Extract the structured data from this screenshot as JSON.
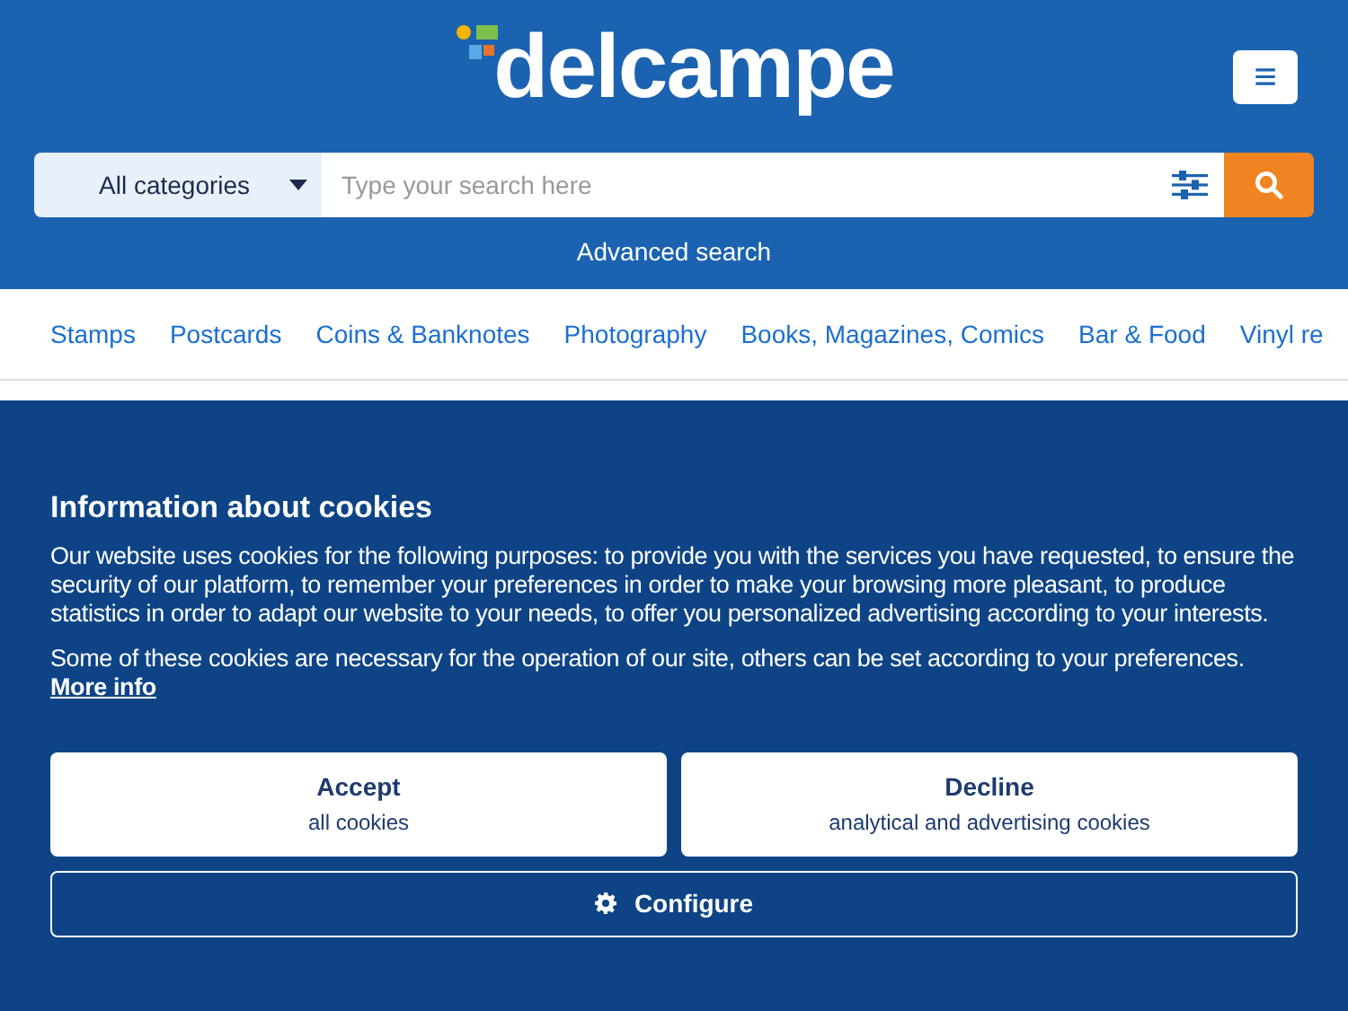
{
  "header": {
    "logo": "delcampe",
    "menu_icon": "≡"
  },
  "search": {
    "category": "All categories",
    "placeholder": "Type your search here",
    "advanced": "Advanced search"
  },
  "nav": [
    "Stamps",
    "Postcards",
    "Coins & Banknotes",
    "Photography",
    "Books, Magazines, Comics",
    "Bar & Food",
    "Vinyl re"
  ],
  "cookies": {
    "title": "Information about cookies",
    "text": "Our website uses cookies for the following purposes: to provide you with the services you have requested, to ensure the security of our platform, to remember your preferences in order to make your browsing more pleasant, to produce statistics in order to adapt our website to your needs, to offer you personalized advertising according to your interests.",
    "text2": "Some of these cookies are necessary for the operation of our site, others can be set according to your preferences.",
    "link": "More info",
    "buttons": [
      {
        "kind": "solid",
        "label": "Accept",
        "sub": "all cookies"
      },
      {
        "kind": "solid",
        "label": "Decline",
        "sub": "analytical and advertising cookies"
      },
      {
        "kind": "outline",
        "label": "Configure"
      }
    ]
  }
}
